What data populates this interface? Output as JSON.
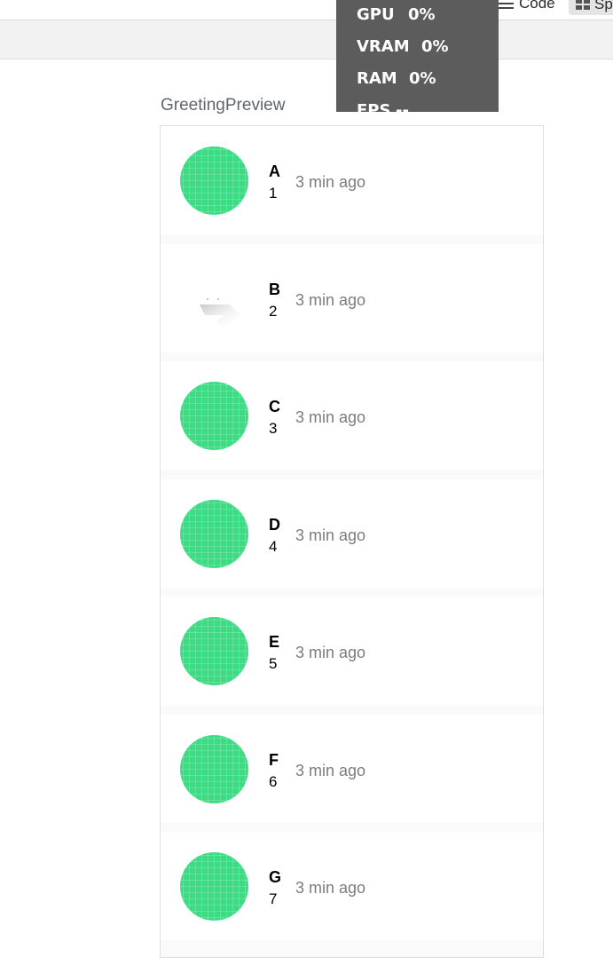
{
  "toolbar": {
    "code_label": "Code",
    "split_label": "Sp"
  },
  "perf": {
    "gpu_label": "GPU",
    "gpu_value": "0%",
    "vram_label": "VRAM",
    "vram_value": "0%",
    "ram_label": "RAM",
    "ram_value": "0%",
    "fps_label": "FPS",
    "fps_value": "--"
  },
  "preview": {
    "title": "GreetingPreview",
    "items": [
      {
        "name": "A",
        "number": "1",
        "time": "3 min ago",
        "image_loaded": true
      },
      {
        "name": "B",
        "number": "2",
        "time": "3 min ago",
        "image_loaded": false
      },
      {
        "name": "C",
        "number": "3",
        "time": "3 min ago",
        "image_loaded": true
      },
      {
        "name": "D",
        "number": "4",
        "time": "3 min ago",
        "image_loaded": true
      },
      {
        "name": "E",
        "number": "5",
        "time": "3 min ago",
        "image_loaded": true
      },
      {
        "name": "F",
        "number": "6",
        "time": "3 min ago",
        "image_loaded": true
      },
      {
        "name": "G",
        "number": "7",
        "time": "3 min ago",
        "image_loaded": true
      }
    ]
  },
  "colors": {
    "avatar": "#3ddc84",
    "perf_bg": "#5c5c5c",
    "time_text": "#7c7c7c"
  }
}
